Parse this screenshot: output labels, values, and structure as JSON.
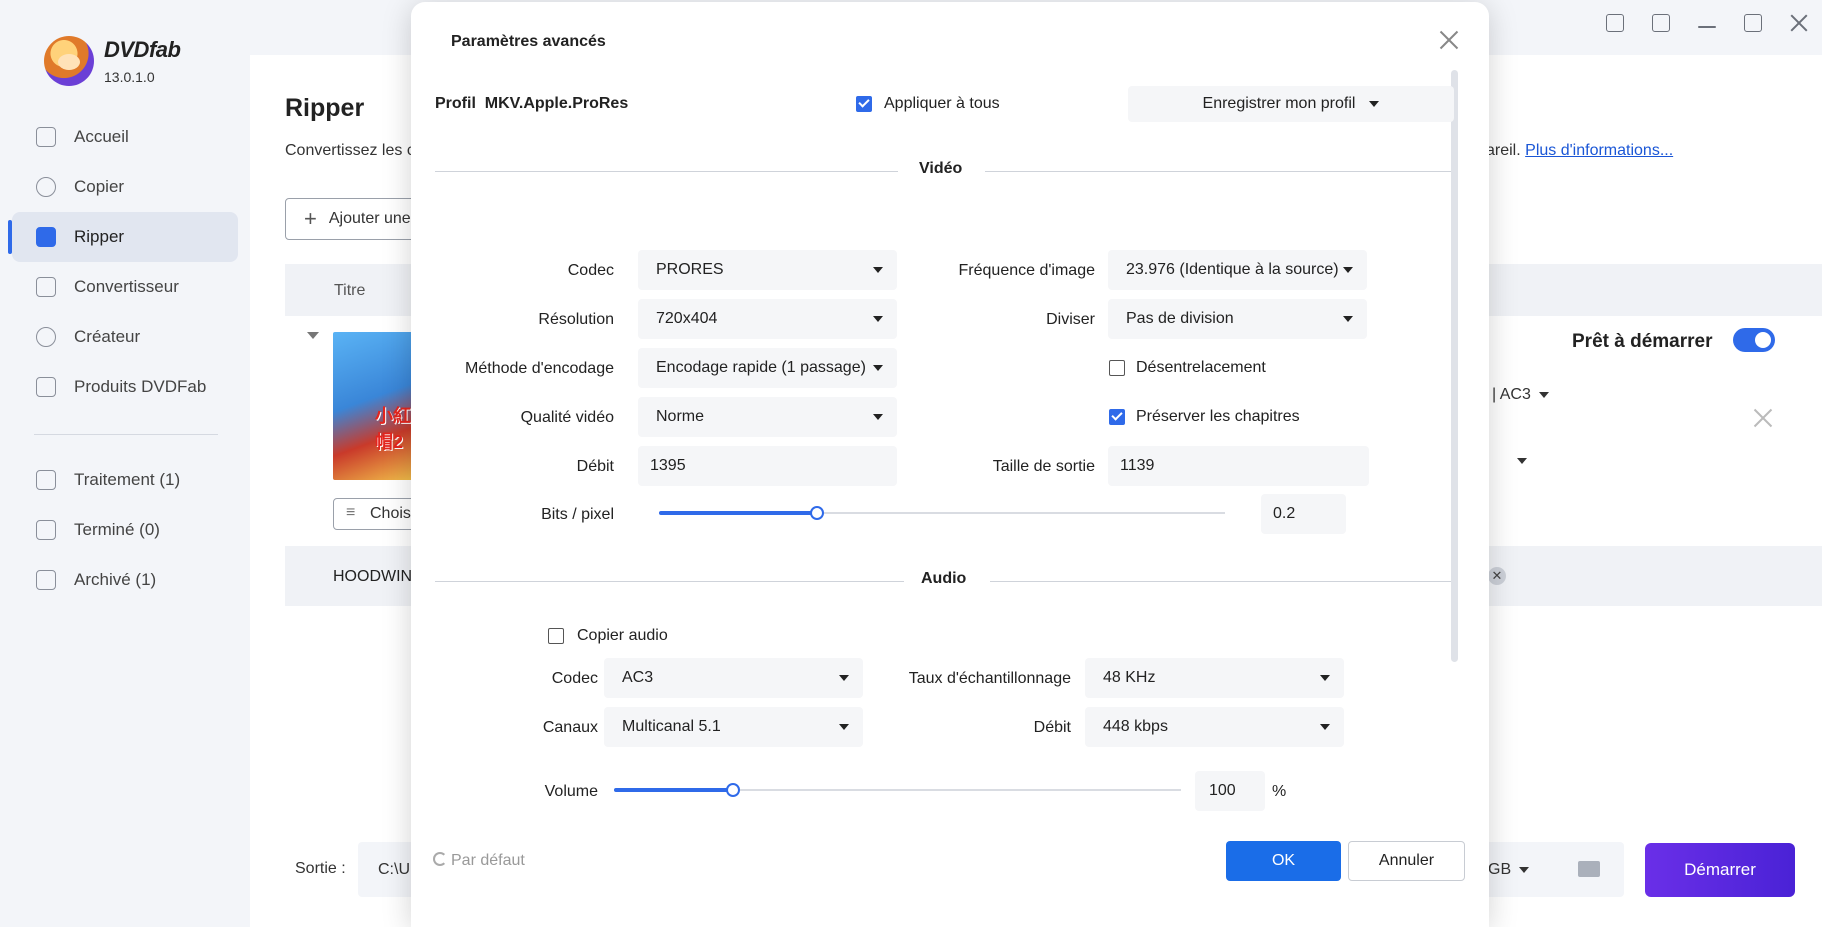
{
  "app": {
    "name": "DVDfab",
    "version": "13.0.1.0"
  },
  "sidebar": {
    "items": [
      {
        "label": "Accueil",
        "icon": "home-icon"
      },
      {
        "label": "Copier",
        "icon": "copy-icon"
      },
      {
        "label": "Ripper",
        "icon": "ripper-icon",
        "active": true
      },
      {
        "label": "Convertisseur",
        "icon": "converter-icon"
      },
      {
        "label": "Créateur",
        "icon": "creator-icon"
      },
      {
        "label": "Produits DVDFab",
        "icon": "products-icon"
      }
    ],
    "queue": [
      {
        "label": "Traitement (1)",
        "icon": "processing-icon"
      },
      {
        "label": "Terminé (0)",
        "icon": "finished-icon"
      },
      {
        "label": "Archivé (1)",
        "icon": "archive-icon"
      }
    ]
  },
  "main": {
    "title": "Ripper",
    "desc_start": "Convertissez les c",
    "desc_end": "areil.",
    "more_link": "Plus d'informations...",
    "add_button": "Ajouter une",
    "column_title": "Titre",
    "choose_button": "Chois",
    "ready_label": "Prêt à démarrer",
    "audio_track": "| AC3",
    "sub_title": "HOODWIN",
    "output_label": "Sortie :",
    "output_path": "C:\\U",
    "size_unit": "GB",
    "start_button": "Démarrer"
  },
  "dialog": {
    "title": "Paramètres avancés",
    "profile_label": "Profil",
    "profile_name": "MKV.Apple.ProRes",
    "apply_all": {
      "label": "Appliquer à tous",
      "checked": true
    },
    "save_profile": "Enregistrer mon profil",
    "video": {
      "section": "Vidéo",
      "codec_label": "Codec",
      "codec_value": "PRORES",
      "framerate_label": "Fréquence d'image",
      "framerate_value": "23.976 (Identique à la source)",
      "resolution_label": "Résolution",
      "resolution_value": "720x404",
      "split_label": "Diviser",
      "split_value": "Pas de division",
      "encoding_label": "Méthode d'encodage",
      "encoding_value": "Encodage rapide (1 passage)",
      "deinterlace": {
        "label": "Désentrelacement",
        "checked": false
      },
      "quality_label": "Qualité vidéo",
      "quality_value": "Norme",
      "chapters": {
        "label": "Préserver les chapitres",
        "checked": true
      },
      "bitrate_label": "Débit",
      "bitrate_value": "1395",
      "output_size_label": "Taille de sortie",
      "output_size_value": "1139",
      "bpp_label": "Bits / pixel",
      "bpp_value": "0.2",
      "bpp_fraction": 0.28
    },
    "audio": {
      "section": "Audio",
      "copy_audio": {
        "label": "Copier audio",
        "checked": false
      },
      "codec_label": "Codec",
      "codec_value": "AC3",
      "samplerate_label": "Taux d'échantillonnage",
      "samplerate_value": "48 KHz",
      "channels_label": "Canaux",
      "channels_value": "Multicanal 5.1",
      "bitrate_label": "Débit",
      "bitrate_value": "448 kbps",
      "volume_label": "Volume",
      "volume_value": "100",
      "volume_unit": "%",
      "volume_fraction": 0.21
    },
    "default_button": "Par défaut",
    "ok_button": "OK",
    "cancel_button": "Annuler"
  },
  "colors": {
    "accent": "#2f6ae9",
    "ok_button": "#1a6de8",
    "start_button": "#5a28e0"
  }
}
